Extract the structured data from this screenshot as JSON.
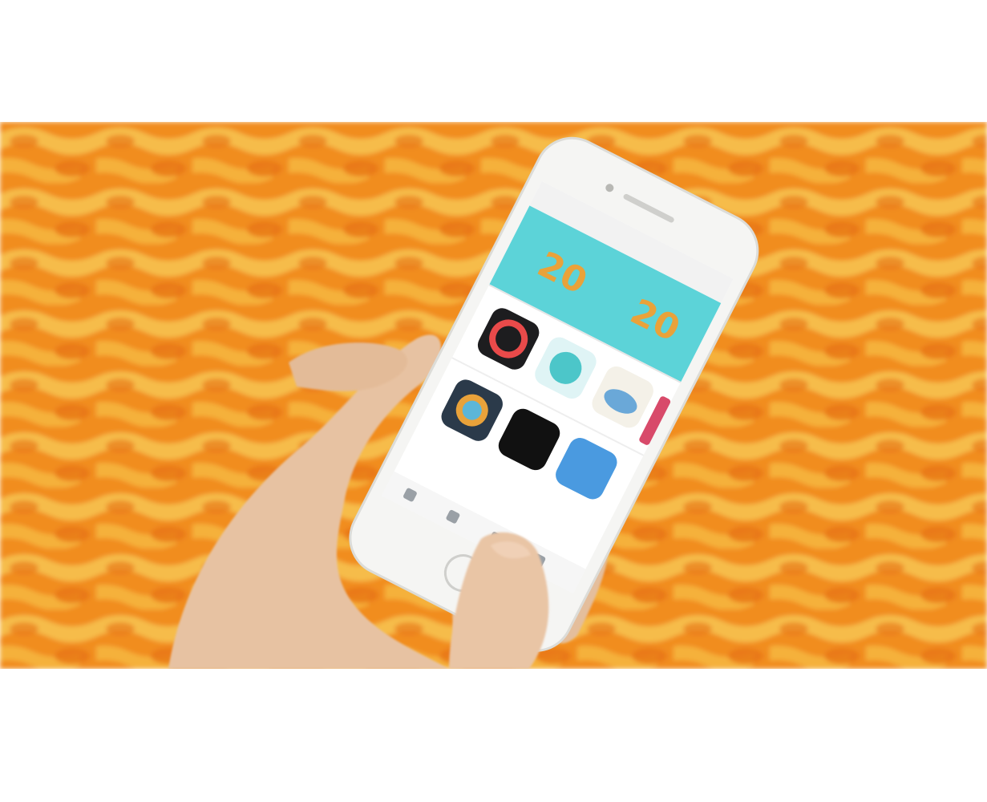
{
  "photo": {
    "kind": "photograph",
    "background_colors": {
      "orange": "#f08a1c",
      "yellow": "#f5c04a",
      "deep": "#e07010"
    },
    "phone": {
      "body_color": "#f5f5f3",
      "screen": {
        "header_color": "#5cd3d8",
        "banner_text_left": "20",
        "banner_text_right": "20",
        "banner_text_color": "#e9a23a",
        "icons": [
          "red-ring-app-icon",
          "teal-circle-app-icon",
          "cloud-app-icon",
          "rainbow-app-icon",
          "dark-app-icon",
          "blue-app-icon",
          "pink-app-icon"
        ]
      }
    },
    "skin_color": "#e7c2a2"
  }
}
